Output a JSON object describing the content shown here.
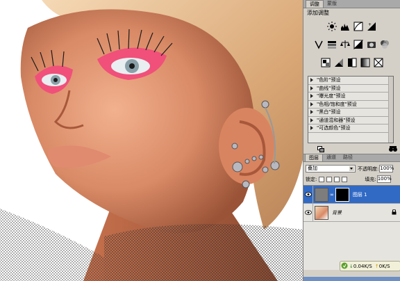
{
  "adjustments_panel": {
    "tabs": [
      "调整",
      "蒙版"
    ],
    "active_tab": "调整",
    "title": "添加调整",
    "icon_rows": [
      [
        "brightness-contrast-icon",
        "levels-icon",
        "curves-icon",
        "exposure-icon"
      ],
      [
        "vibrance-icon",
        "hue-saturation-icon",
        "color-balance-icon",
        "black-white-icon",
        "photo-filter-icon",
        "channel-mixer-icon"
      ],
      [
        "invert-icon",
        "posterize-icon",
        "threshold-icon",
        "gradient-map-icon",
        "selective-color-icon"
      ]
    ],
    "presets": [
      "\"色阶\"预设",
      "\"曲线\"预设",
      "\"曝光度\"预设",
      "\"色相/饱和度\"预设",
      "\"黑白\"预设",
      "\"通道混和器\"预设",
      "\"可选颜色\"预设"
    ]
  },
  "layers_panel": {
    "tabs": [
      "图层",
      "通道",
      "路径"
    ],
    "active_tab": "图层",
    "blend_mode": "叠加",
    "opacity_label": "不透明度:",
    "opacity_value": "100%",
    "lock_label": "锁定:",
    "fill_label": "填充:",
    "fill_value": "100%",
    "layers": [
      {
        "name": "图层 1",
        "selected": true
      },
      {
        "name": "背景",
        "selected": false
      }
    ]
  },
  "net_meter": {
    "down": "0.04K/S",
    "up": "0K/S"
  },
  "colors": {
    "selection": "#316ac5",
    "panel_bg": "#d4d0c8"
  }
}
